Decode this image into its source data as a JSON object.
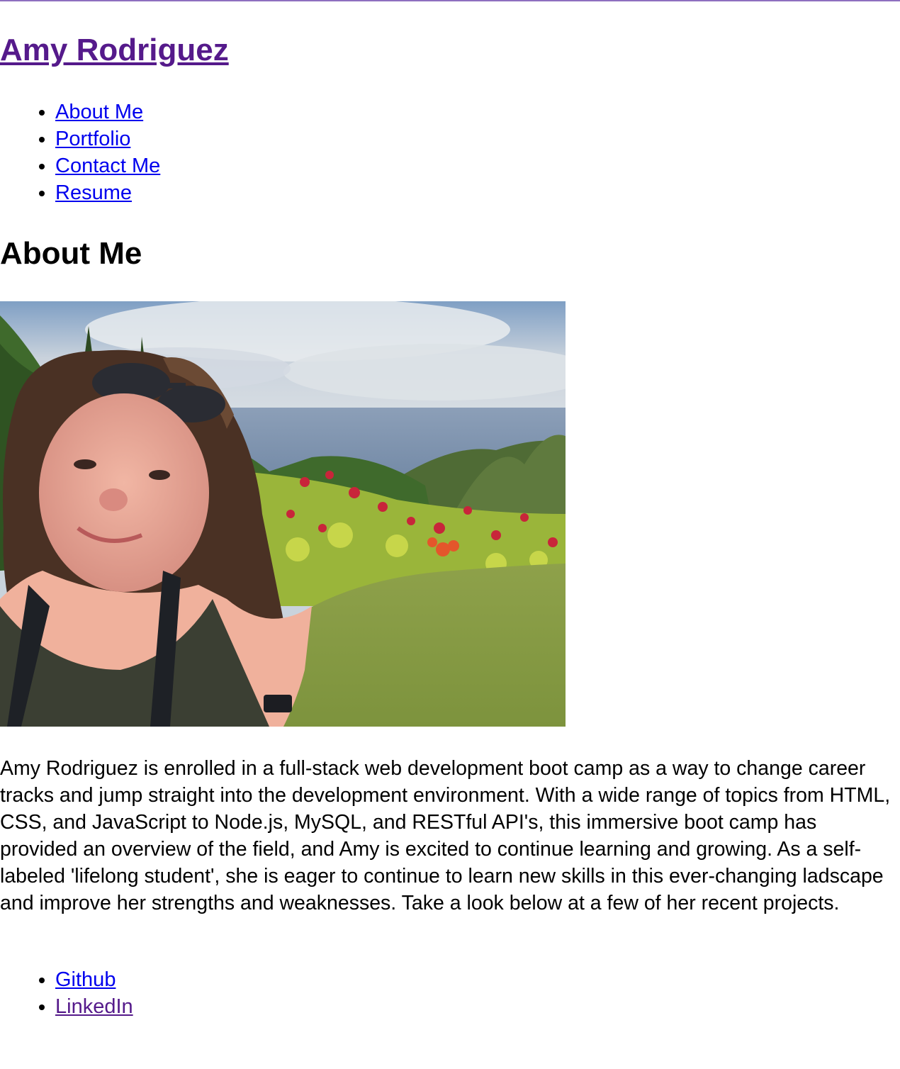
{
  "header": {
    "site_title": "Amy Rodriguez"
  },
  "nav": {
    "items": [
      {
        "label": "About Me"
      },
      {
        "label": "Portfolio"
      },
      {
        "label": "Contact Me"
      },
      {
        "label": "Resume"
      }
    ]
  },
  "main": {
    "section_title": "About Me",
    "photo": {
      "description_icon": "profile-photo"
    },
    "bio": "Amy Rodriguez is enrolled in a full-stack web development boot camp as a way to change career tracks and jump straight into the development environment. With a wide range of topics from HTML, CSS, and JavaScript to Node.js, MySQL, and RESTful API's, this immersive boot camp has provided an overview of the field, and Amy is excited to continue learning and growing. As a self-labeled 'lifelong student', she is eager to continue to learn new skills in this ever-changing ladscape and improve her strengths and weaknesses. Take a look below at a few of her recent projects."
  },
  "social": {
    "items": [
      {
        "label": "Github"
      },
      {
        "label": "LinkedIn"
      }
    ]
  },
  "colors": {
    "link": "#0000ee",
    "visited_link": "#551a8b",
    "top_rule": "#8e6fbf"
  }
}
